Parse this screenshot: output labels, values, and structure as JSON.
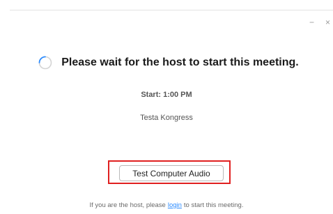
{
  "window": {
    "minimize_glyph": "−",
    "close_glyph": "×"
  },
  "status": {
    "spinner_icon": "loading-spinner",
    "message": "Please wait for the host to start this meeting."
  },
  "meeting": {
    "start_time": "Start: 1:00 PM",
    "name": "Testa Kongress"
  },
  "actions": {
    "test_audio_label": "Test Computer Audio"
  },
  "footer": {
    "text_before": "If you are the host, please",
    "login_link": "login",
    "text_after": "to start this meeting."
  },
  "colors": {
    "link": "#2d8cff",
    "highlight": "#e02020",
    "spinner": "#2d8cff"
  }
}
